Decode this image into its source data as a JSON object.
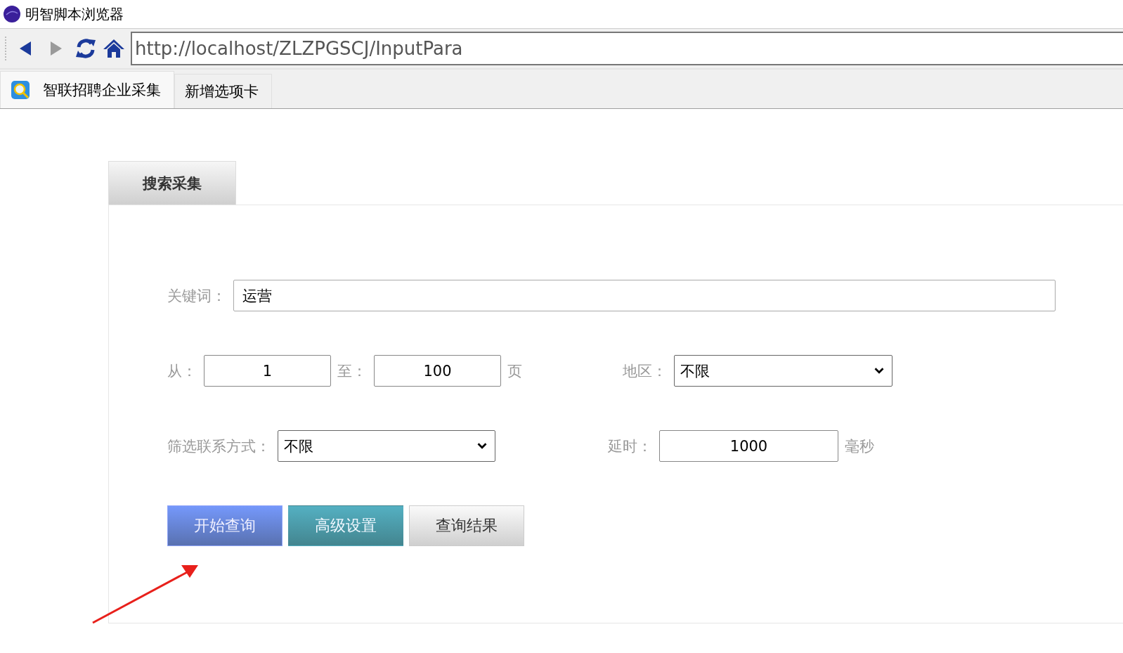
{
  "window": {
    "title": "明智脚本浏览器"
  },
  "toolbar": {
    "back_disabled": false,
    "forward_disabled": true,
    "address": "http://localhost/ZLZPGSCJ/InputPara"
  },
  "tabs": [
    {
      "label": "智联招聘企业采集",
      "selected": true
    },
    {
      "label": "新增选项卡",
      "selected": false
    }
  ],
  "panel_tabs": [
    {
      "label": "搜索采集",
      "selected": true
    }
  ],
  "form": {
    "keyword_label": "关键词：",
    "keyword_value": "运营",
    "from_label": "从：",
    "from_value": "1",
    "to_label": "至：",
    "to_value": "100",
    "page_unit": "页",
    "region_label": "地区：",
    "region_value": "不限",
    "contact_label": "筛选联系方式：",
    "contact_value": "不限",
    "delay_label": "延时：",
    "delay_value": "1000",
    "delay_unit": "毫秒"
  },
  "buttons": [
    {
      "label": "开始查询",
      "kind": "primary"
    },
    {
      "label": "高级设置",
      "kind": "info"
    },
    {
      "label": "查询结果",
      "kind": "default"
    }
  ]
}
